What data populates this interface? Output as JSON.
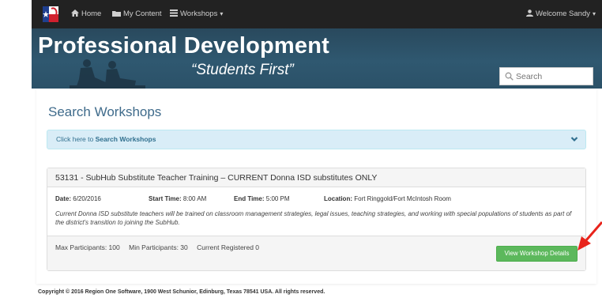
{
  "nav": {
    "home": "Home",
    "my_content": "My Content",
    "workshops": "Workshops",
    "user": "Welcome Sandy"
  },
  "banner": {
    "title": "Professional Development",
    "tagline": "“Students First”",
    "search_placeholder": "Search"
  },
  "page": {
    "heading": "Search Workshops",
    "search_toggle_prefix": "Click here to ",
    "search_toggle_bold": "Search Workshops"
  },
  "workshop": {
    "title": "53131 - SubHub Substitute Teacher Training – CURRENT Donna ISD substitutes ONLY",
    "date_label": "Date:",
    "date": "6/20/2016",
    "start_label": "Start Time:",
    "start_time": "8:00 AM",
    "end_label": "End Time:",
    "end_time": "5:00 PM",
    "location_label": "Location:",
    "location": "Fort Ringgold/Fort McIntosh Room",
    "description": "Current Donna ISD substitute teachers will be trained on classroom management strategies, legal issues, teaching strategies, and working with special populations of students as part of the district's transition to joining the SubHub.",
    "max_participants": "Max Participants: 100",
    "min_participants": "Min Participants: 30",
    "current_registered": "Current Registered 0",
    "details_button": "View Workshop Details"
  },
  "footer": {
    "copyright": "Copyright © 2016 Region One Software, 1900 West Schunior, Edinburg, Texas 78541 USA. All rights reserved."
  },
  "colors": {
    "navbar": "#222222",
    "banner": "#2f5870",
    "heading": "#3f6b8b",
    "info_panel": "#d9edf7",
    "button": "#5cb85c",
    "annotation_arrow": "#e8231b"
  },
  "icons": [
    "texas-flag-logo-icon",
    "home-icon",
    "folder-icon",
    "list-icon",
    "user-icon",
    "search-icon",
    "chevron-down-icon"
  ]
}
